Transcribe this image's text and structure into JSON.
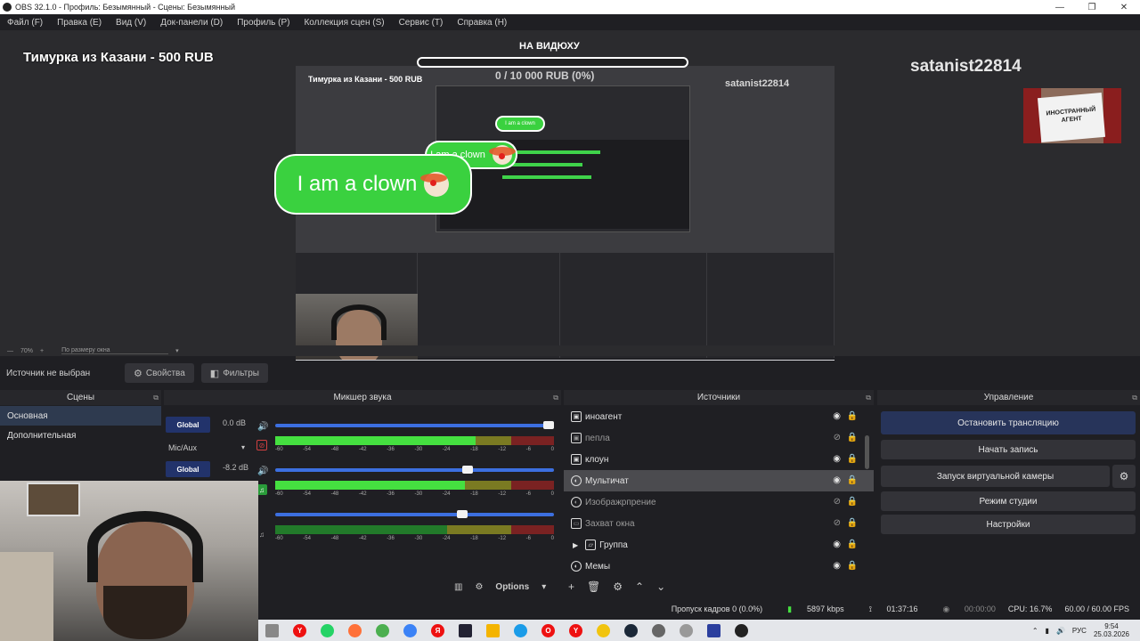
{
  "window": {
    "title": "OBS 32.1.0 - Профиль: Безымянный - Сцены: Безымянный"
  },
  "menu": [
    "Файл (F)",
    "Правка (E)",
    "Вид (V)",
    "Док-панели (D)",
    "Профиль (P)",
    "Коллекция сцен (S)",
    "Сервис (T)",
    "Справка (H)"
  ],
  "overlay": {
    "donation_text": "Тимурка из Казани - 500 RUB",
    "goal_title": "НА ВИДЮХУ",
    "goal_progress": 0,
    "goal_text": "0 / 10 000 RUB (0%)",
    "username": "satanist22814",
    "clown_text": "I am a clown",
    "agent_sign": "ИНОСТРАННЫЙ АГЕНТ"
  },
  "nested_preview": {
    "donation_text": "Тимурка из Казани - 500 RUB",
    "username": "satanist22814"
  },
  "zoom": {
    "level": "70%",
    "mode": "По размеру окна"
  },
  "source_toolbar": {
    "no_source": "Источник не выбран",
    "properties": "Свойства",
    "filters": "Фильтры"
  },
  "scenes": {
    "title": "Сцены",
    "items": [
      "Основная",
      "Дополнительная"
    ],
    "active_index": 0
  },
  "mixer": {
    "title": "Микшер звука",
    "channels": [
      {
        "button": "Global",
        "db": "0.0 dB",
        "name": "Mic/Aux",
        "level": 0.72,
        "slider": 0.98
      },
      {
        "button": "Global",
        "db": "-8.2 dB",
        "name": "",
        "level": 0.68,
        "slider": 0.69
      },
      {
        "button": "",
        "db": "",
        "name": "",
        "level": 0.0,
        "slider": 0.67
      }
    ],
    "scale": [
      "-60",
      "-54",
      "-48",
      "-42",
      "-36",
      "-30",
      "-24",
      "-18",
      "-12",
      "-6",
      "0"
    ],
    "options_label": "Options"
  },
  "sources": {
    "title": "Источники",
    "items": [
      {
        "name": "иноагент",
        "icon": "image-icon",
        "visible": true,
        "locked": true
      },
      {
        "name": "пепла",
        "icon": "image-icon",
        "visible": false,
        "locked": true
      },
      {
        "name": "клоун",
        "icon": "image-icon",
        "visible": true,
        "locked": true
      },
      {
        "name": "Мультичат",
        "icon": "browser-icon",
        "visible": true,
        "locked": true
      },
      {
        "name": "Изображрпрение",
        "icon": "browser-icon",
        "visible": false,
        "locked": true
      },
      {
        "name": "Захват окна",
        "icon": "window-icon",
        "visible": false,
        "locked": true
      },
      {
        "name": "Группа",
        "icon": "folder-icon",
        "visible": true,
        "locked": true
      },
      {
        "name": "Мемы",
        "icon": "browser-icon",
        "visible": true,
        "locked": true
      }
    ],
    "active_index": 3
  },
  "controls": {
    "title": "Управление",
    "stop_stream": "Остановить трансляцию",
    "start_recording": "Начать запись",
    "virtual_camera": "Запуск виртуальной камеры",
    "studio_mode": "Режим студии",
    "settings": "Настройки"
  },
  "status": {
    "dropped_frames": "Пропуск кадров 0 (0.0%)",
    "bitrate": "5897 kbps",
    "stream_time": "01:37:16",
    "record_time": "00:00:00",
    "cpu": "CPU: 16.7%",
    "fps": "60.00 / 60.00 FPS"
  },
  "taskbar": {
    "lang": "РУС",
    "time": "9:54",
    "date": "25.03.2026"
  },
  "colors": {
    "accent": "#3c6fe0",
    "meter_green": "#45e040",
    "active_scene": "#2e3a4f",
    "stop_button": "#27345a"
  }
}
